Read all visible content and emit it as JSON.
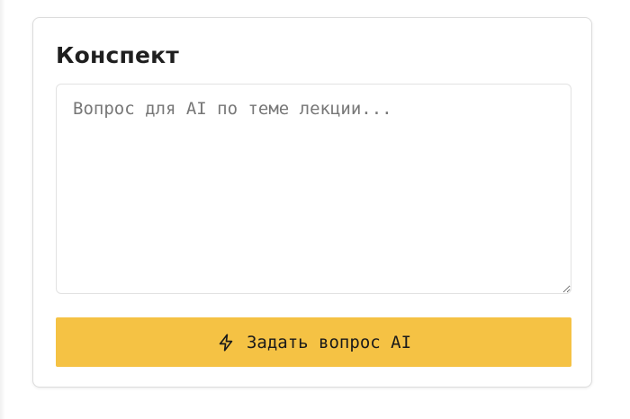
{
  "panel": {
    "title": "Конспект",
    "question_placeholder": "Вопрос для AI по теме лекции...",
    "question_value": "",
    "ask_button_label": "Задать вопрос AI",
    "ask_button_icon": "lightning-icon"
  },
  "colors": {
    "button_background": "#f5c244",
    "card_border": "#dcdcdc",
    "title_text": "#1f1f1f",
    "placeholder_text": "#777777"
  }
}
